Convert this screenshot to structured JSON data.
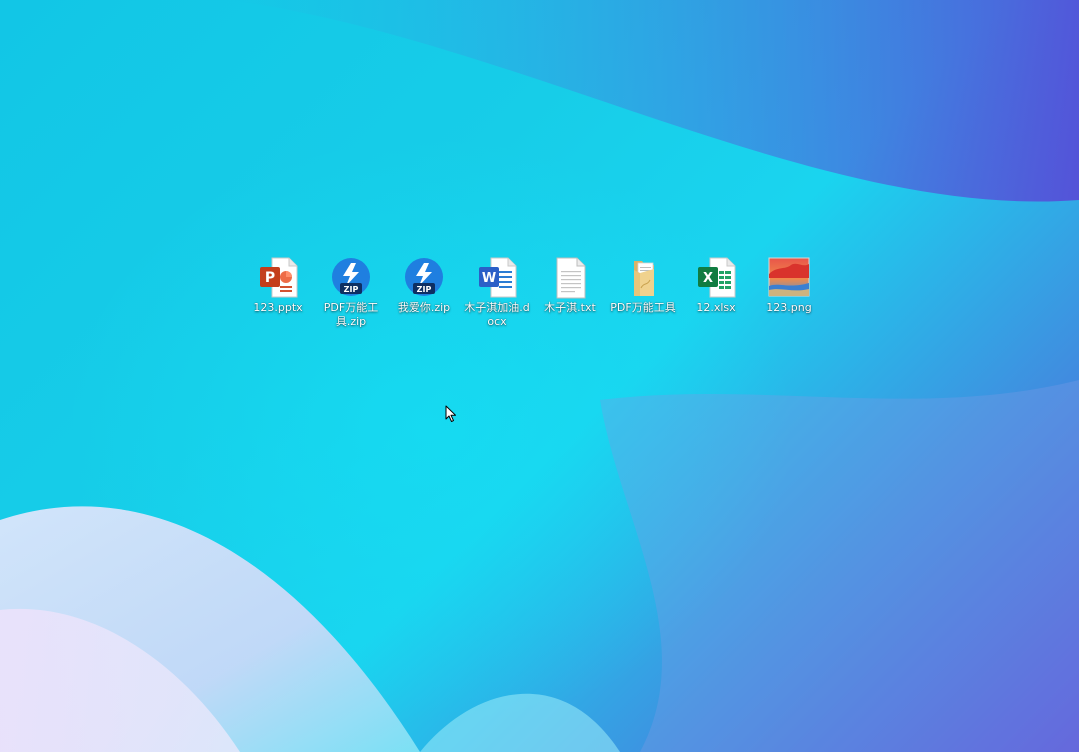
{
  "desktop": {
    "icons": [
      {
        "label": "123.pptx",
        "icon": "powerpoint-file-icon"
      },
      {
        "label": "PDF万能工具.zip",
        "icon": "zip-archive-icon"
      },
      {
        "label": "我爱你.zip",
        "icon": "zip-archive-icon"
      },
      {
        "label": "木子淇加油.docx",
        "icon": "word-document-icon"
      },
      {
        "label": "木子淇.txt",
        "icon": "text-file-icon"
      },
      {
        "label": "PDF万能工具",
        "icon": "folder-icon"
      },
      {
        "label": "12.xlsx",
        "icon": "excel-file-icon"
      },
      {
        "label": "123.png",
        "icon": "image-file-icon"
      }
    ],
    "zip_badge_text": "ZIP",
    "ppt_letter": "P",
    "word_letter": "W",
    "excel_letter": "X"
  },
  "colors": {
    "wallpaper_cyan": "#17cde8",
    "wallpaper_purple": "#5a4ed8",
    "label_text": "#ffffff",
    "ppt_red": "#c43e1c",
    "word_blue": "#2b5fc7",
    "excel_green": "#107c41",
    "zip_blue": "#1f7fe0",
    "folder_tan": "#e8c57a"
  }
}
